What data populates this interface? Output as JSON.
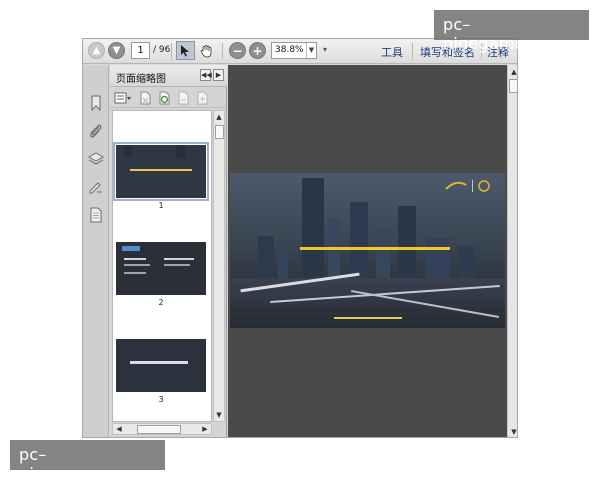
{
  "toolbar": {
    "page_current": "1",
    "page_total": "/ 96",
    "zoom": "38.8%",
    "menu_tools": "工具",
    "menu_sign": "填写和签名",
    "menu_comment": "注释"
  },
  "panel": {
    "title": "页面缩略图",
    "thumbnails": [
      {
        "num": "1"
      },
      {
        "num": "2"
      },
      {
        "num": "3"
      }
    ]
  },
  "watermark": {
    "text": "pc–ninegame.com"
  },
  "colors": {
    "doc_background": "#4a4a4a",
    "slide_title": "#f4e21e",
    "menu_text": "#1a3d78"
  }
}
